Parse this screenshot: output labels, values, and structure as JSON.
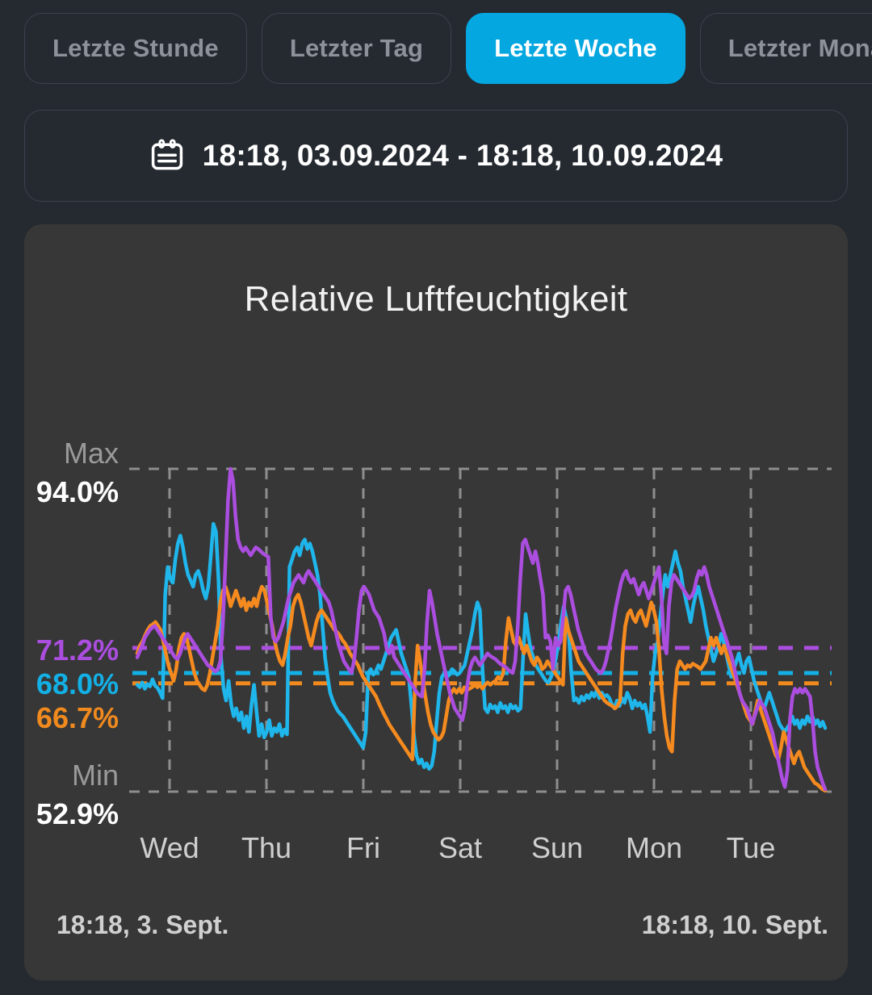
{
  "range_tabs": {
    "items": [
      {
        "label": "Letzte Stunde",
        "active": false
      },
      {
        "label": "Letzter Tag",
        "active": false
      },
      {
        "label": "Letzte Woche",
        "active": true
      },
      {
        "label": "Letzter Monat",
        "active": false
      }
    ],
    "active_color": "#04a7e0",
    "inactive_text_color": "#8d9199"
  },
  "date_range": {
    "icon": "calendar-icon",
    "text": "18:18,  03.09.2024 - 18:18,  10.09.2024"
  },
  "card": {
    "background": "#373737"
  },
  "footer": {
    "left": "18:18,  3. Sept.",
    "right": "18:18,  10. Sept."
  },
  "chart_data": {
    "type": "line",
    "title": "Relative Luftfeuchtigkeit",
    "xlabel": "",
    "ylabel": "",
    "unit": "%",
    "ylim": [
      52.9,
      94.0
    ],
    "grid": true,
    "legend_position": "none",
    "axis_annotations": {
      "max_caption": "Max",
      "max_value": "94.0%",
      "min_caption": "Min",
      "min_value": "52.9%"
    },
    "tick_labels_x": [
      "Wed",
      "Thu",
      "Fri",
      "Sat",
      "Sun",
      "Mon",
      "Tue"
    ],
    "threshold_lines": [
      {
        "name": "purple-average",
        "label": "71.2%",
        "value": 71.2,
        "color": "#ab4ee0"
      },
      {
        "name": "cyan-average",
        "label": "68.0%",
        "value": 68.0,
        "color": "#13b0e6"
      },
      {
        "name": "orange-average",
        "label": "66.7%",
        "value": 66.7,
        "color": "#f08a1e"
      }
    ],
    "series": [
      {
        "name": "sensor-cyan",
        "color": "#1fb6ec",
        "values": [
          66.5,
          66.2,
          66.8,
          66.0,
          66.6,
          66.3,
          67.2,
          66.4,
          66.1,
          65.5,
          64.8,
          78.0,
          81.5,
          80.0,
          79.5,
          82.5,
          84.5,
          85.5,
          84.0,
          82.0,
          80.5,
          79.8,
          79.0,
          80.5,
          81.0,
          80.0,
          78.5,
          77.5,
          79.0,
          83.0,
          87.0,
          86.0,
          80.0,
          70.0,
          66.0,
          64.5,
          67.0,
          64.0,
          62.5,
          63.5,
          62.0,
          63.0,
          61.0,
          62.5,
          60.5,
          64.0,
          66.5,
          63.0,
          60.0,
          61.5,
          59.8,
          60.5,
          62.0,
          60.0,
          61.0,
          60.5,
          61.5,
          60.0,
          60.8,
          60.2,
          81.5,
          82.5,
          83.5,
          84.0,
          83.0,
          84.5,
          85.0,
          83.8,
          84.5,
          83.5,
          82.0,
          80.5,
          78.0,
          74.0,
          70.0,
          67.5,
          65.5,
          64.5,
          63.8,
          63.2,
          62.8,
          62.5,
          62.0,
          61.5,
          61.0,
          60.5,
          60.0,
          59.5,
          59.0,
          58.5,
          60.5,
          68.0,
          68.5,
          67.8,
          68.2,
          69.0,
          68.5,
          69.5,
          70.5,
          71.5,
          72.5,
          73.0,
          73.5,
          72.0,
          70.5,
          69.5,
          68.5,
          67.5,
          64.0,
          60.0,
          57.5,
          56.5,
          57.0,
          56.0,
          56.5,
          55.8,
          56.2,
          58.0,
          62.0,
          65.5,
          67.5,
          68.0,
          67.5,
          67.8,
          68.5,
          68.2,
          67.8,
          68.0,
          68.5,
          69.0,
          70.5,
          72.0,
          73.5,
          75.5,
          77.0,
          76.0,
          68.5,
          63.5,
          63.0,
          64.0,
          63.5,
          63.8,
          63.0,
          64.2,
          63.5,
          63.8,
          63.0,
          64.0,
          63.5,
          63.8,
          63.2,
          63.5,
          70.0,
          75.5,
          73.0,
          71.0,
          70.0,
          69.0,
          68.5,
          68.0,
          67.5,
          67.0,
          66.8,
          67.5,
          68.5,
          70.0,
          72.0,
          74.5,
          76.5,
          75.0,
          73.0,
          68.0,
          64.5,
          64.8,
          64.2,
          65.0,
          64.5,
          65.2,
          64.8,
          65.5,
          65.0,
          65.8,
          64.8,
          65.5,
          65.0,
          65.2,
          64.8,
          64.0,
          63.5,
          64.5,
          63.8,
          64.8,
          64.2,
          65.5,
          64.8,
          63.5,
          64.5,
          63.8,
          64.2,
          63.5,
          64.0,
          62.5,
          60.5,
          67.5,
          70.5,
          72.0,
          75.0,
          78.0,
          80.5,
          79.0,
          80.5,
          82.0,
          83.5,
          82.0,
          81.0,
          79.0,
          77.5,
          76.0,
          74.5,
          76.5,
          78.0,
          79.0,
          77.5,
          76.0,
          74.0,
          72.5,
          71.0,
          69.5,
          70.5,
          71.5,
          73.0,
          72.0,
          70.5,
          69.0,
          67.5,
          68.5,
          69.5,
          70.5,
          69.0,
          68.0,
          69.5,
          70.0,
          68.5,
          67.0,
          66.0,
          65.0,
          64.0,
          63.5,
          64.5,
          65.5,
          64.5,
          63.5,
          62.5,
          61.5,
          61.0,
          60.5,
          61.0,
          61.5,
          62.5,
          61.5,
          62.0,
          61.0,
          62.0,
          61.5,
          62.5,
          61.8,
          62.5,
          61.5,
          62.0,
          61.2,
          61.8,
          61.0
        ]
      },
      {
        "name": "sensor-orange",
        "color": "#f58a1f",
        "values": [
          70.5,
          71.5,
          72.0,
          72.8,
          73.5,
          74.0,
          74.2,
          74.5,
          74.0,
          73.5,
          72.0,
          70.5,
          69.0,
          68.0,
          67.0,
          68.5,
          71.0,
          72.5,
          73.0,
          72.5,
          71.0,
          69.5,
          68.0,
          67.0,
          66.5,
          66.0,
          65.8,
          66.5,
          68.0,
          70.0,
          72.0,
          74.0,
          77.0,
          78.5,
          79.0,
          78.0,
          76.5,
          77.5,
          78.5,
          77.5,
          76.5,
          77.5,
          76.0,
          77.0,
          76.5,
          77.5,
          76.5,
          78.0,
          79.0,
          78.5,
          77.0,
          75.5,
          74.0,
          72.0,
          70.5,
          69.5,
          69.0,
          70.5,
          72.5,
          74.0,
          76.5,
          77.5,
          78.0,
          77.0,
          75.5,
          74.0,
          72.5,
          71.5,
          73.0,
          74.5,
          75.5,
          76.0,
          75.5,
          75.0,
          74.5,
          74.0,
          73.5,
          73.2,
          72.8,
          72.2,
          71.8,
          71.2,
          70.5,
          70.0,
          69.5,
          69.0,
          68.2,
          67.5,
          67.0,
          66.5,
          66.0,
          65.5,
          65.0,
          64.2,
          63.5,
          62.8,
          62.2,
          61.5,
          61.0,
          60.5,
          60.0,
          59.5,
          59.0,
          58.5,
          58.0,
          57.5,
          57.0,
          66.5,
          71.5,
          69.5,
          67.0,
          65.0,
          63.0,
          61.5,
          60.5,
          60.0,
          59.5,
          59.8,
          60.5,
          62.5,
          64.5,
          65.5,
          66.0,
          65.5,
          66.0,
          65.5,
          66.2,
          65.8,
          66.0,
          66.2,
          66.5,
          66.2,
          66.5,
          66.0,
          66.5,
          66.8,
          66.5,
          66.8,
          67.0,
          67.5,
          67.2,
          68.0,
          72.0,
          75.0,
          73.5,
          72.0,
          71.5,
          72.5,
          71.5,
          70.5,
          71.5,
          70.5,
          69.5,
          69.0,
          70.0,
          69.5,
          68.5,
          68.8,
          69.5,
          69.0,
          68.5,
          68.0,
          67.5,
          67.0,
          66.5,
          75.0,
          73.5,
          72.5,
          71.5,
          70.5,
          69.5,
          69.0,
          68.5,
          68.0,
          67.5,
          67.0,
          66.5,
          66.0,
          65.5,
          65.0,
          64.5,
          64.2,
          64.0,
          63.8,
          63.5,
          63.8,
          64.5,
          70.5,
          74.0,
          75.5,
          76.0,
          75.0,
          74.5,
          75.5,
          76.0,
          75.0,
          74.0,
          75.5,
          77.0,
          76.0,
          74.5,
          71.0,
          66.0,
          62.5,
          60.0,
          58.5,
          58.0,
          64.5,
          68.5,
          69.5,
          69.0,
          68.5,
          69.0,
          68.8,
          69.2,
          69.0,
          68.8,
          68.5,
          69.0,
          69.5,
          71.0,
          72.5,
          71.5,
          72.5,
          71.5,
          70.5,
          71.5,
          70.5,
          69.5,
          68.5,
          67.5,
          66.5,
          65.5,
          64.5,
          63.5,
          62.5,
          62.0,
          61.5,
          63.0,
          64.5,
          63.5,
          62.5,
          61.5,
          60.5,
          59.5,
          58.5,
          57.5,
          57.0,
          58.5,
          60.5,
          59.5,
          58.5,
          57.5,
          56.5,
          57.5,
          58.0,
          57.0,
          56.0,
          55.5,
          55.0,
          54.5,
          54.0,
          53.8,
          53.5,
          53.2,
          53.0
        ]
      },
      {
        "name": "sensor-purple",
        "color": "#ab4ee0",
        "values": [
          70.0,
          70.8,
          71.5,
          72.5,
          73.0,
          73.5,
          73.8,
          74.0,
          73.5,
          73.0,
          72.5,
          72.0,
          71.5,
          71.0,
          70.5,
          70.0,
          69.8,
          70.5,
          71.5,
          72.5,
          73.0,
          72.5,
          72.0,
          71.5,
          71.0,
          70.5,
          70.0,
          69.5,
          69.0,
          68.8,
          68.5,
          68.2,
          68.5,
          69.5,
          74.5,
          82.0,
          90.0,
          94.0,
          92.5,
          88.0,
          85.0,
          84.0,
          83.5,
          84.0,
          83.5,
          83.0,
          83.5,
          84.0,
          83.8,
          83.5,
          83.2,
          83.0,
          82.8,
          75.0,
          72.5,
          72.0,
          72.5,
          73.5,
          74.5,
          76.0,
          77.5,
          78.5,
          79.5,
          80.0,
          80.5,
          80.0,
          79.5,
          80.5,
          81.0,
          80.5,
          80.0,
          79.5,
          79.0,
          78.5,
          78.0,
          77.5,
          77.0,
          76.0,
          74.5,
          73.0,
          71.5,
          70.5,
          69.5,
          69.0,
          68.5,
          68.0,
          69.5,
          72.5,
          76.0,
          78.5,
          79.0,
          78.5,
          78.0,
          77.0,
          76.0,
          75.5,
          75.0,
          74.0,
          73.0,
          71.0,
          70.5,
          71.5,
          70.0,
          69.5,
          69.0,
          68.5,
          68.0,
          67.5,
          67.0,
          66.5,
          66.0,
          65.5,
          65.2,
          65.0,
          68.5,
          74.5,
          78.5,
          77.0,
          75.0,
          73.0,
          71.5,
          70.0,
          68.5,
          67.0,
          65.5,
          64.5,
          63.5,
          63.0,
          62.5,
          62.0,
          63.5,
          66.5,
          68.5,
          69.5,
          70.0,
          69.5,
          69.0,
          69.5,
          70.0,
          70.5,
          70.2,
          70.0,
          69.8,
          69.5,
          69.2,
          69.0,
          68.8,
          68.5,
          68.2,
          68.0,
          69.5,
          74.0,
          80.0,
          84.5,
          85.0,
          84.0,
          83.0,
          82.0,
          83.5,
          82.0,
          80.0,
          78.0,
          72.5,
          72.8,
          72.0,
          68.5,
          72.5,
          71.5,
          72.0,
          75.0,
          78.5,
          79.0,
          78.0,
          76.5,
          75.0,
          73.5,
          72.5,
          71.5,
          70.5,
          70.0,
          69.5,
          69.0,
          68.5,
          68.2,
          68.0,
          68.5,
          69.5,
          71.0,
          72.5,
          74.5,
          76.5,
          78.0,
          79.5,
          80.5,
          81.0,
          80.0,
          79.5,
          80.0,
          79.0,
          78.0,
          79.0,
          79.5,
          78.5,
          77.5,
          78.5,
          79.5,
          80.5,
          81.5,
          78.0,
          72.0,
          70.5,
          76.5,
          79.5,
          80.5,
          80.0,
          79.5,
          79.0,
          78.5,
          78.0,
          77.5,
          77.8,
          78.5,
          80.0,
          81.0,
          80.5,
          81.5,
          80.5,
          79.0,
          78.0,
          77.0,
          76.0,
          75.0,
          74.0,
          73.0,
          72.0,
          71.0,
          70.0,
          68.5,
          67.0,
          65.5,
          64.5,
          64.0,
          63.5,
          62.5,
          61.5,
          62.5,
          63.5,
          64.5,
          64.0,
          63.5,
          62.5,
          61.5,
          60.5,
          59.0,
          57.5,
          56.0,
          54.5,
          53.5,
          55.5,
          62.0,
          65.0,
          66.0,
          65.5,
          66.0,
          65.5,
          66.0,
          65.5,
          65.0,
          62.0,
          58.0,
          56.0,
          55.0,
          54.0,
          53.2
        ]
      }
    ]
  }
}
